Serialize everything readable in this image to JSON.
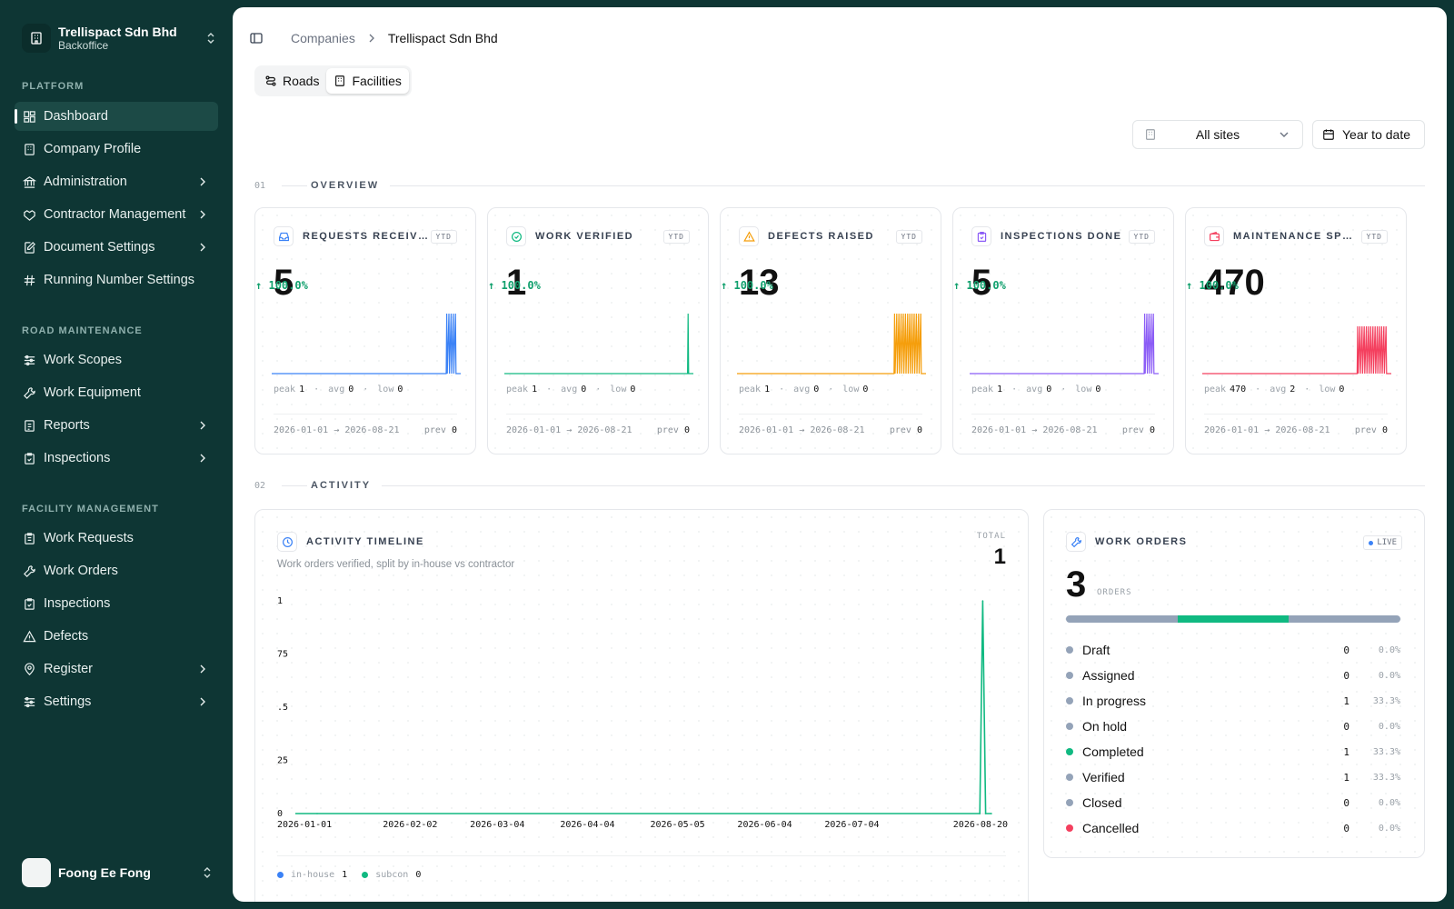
{
  "org": {
    "name": "Trellispact Sdn Bhd",
    "sub": "Backoffice"
  },
  "nav": {
    "platform_label": "PLATFORM",
    "platform": [
      "Dashboard",
      "Company Profile",
      "Administration",
      "Contractor Management",
      "Document Settings",
      "Running Number Settings"
    ],
    "road_label": "ROAD MAINTENANCE",
    "road": [
      "Work Scopes",
      "Work Equipment",
      "Reports",
      "Inspections"
    ],
    "facility_label": "FACILITY MANAGEMENT",
    "facility": [
      "Work Requests",
      "Work Orders",
      "Inspections",
      "Defects",
      "Register",
      "Settings"
    ]
  },
  "user": {
    "name": "Foong Ee Fong"
  },
  "breadcrumb": {
    "parent": "Companies",
    "current": "Trellispact Sdn Bhd"
  },
  "tabs": [
    "Roads",
    "Facilities"
  ],
  "filters": {
    "site": "All sites",
    "range": "Year to date"
  },
  "sections": {
    "overview": {
      "num": "01",
      "title": "OVERVIEW"
    },
    "activity": {
      "num": "02",
      "title": "ACTIVITY"
    }
  },
  "kpis": [
    {
      "title": "REQUESTS RECEIV…",
      "badge": "YTD",
      "value": "5",
      "delta": "100.0%",
      "peak": "1",
      "avg": "0",
      "low": "0",
      "from": "2026-01-01",
      "to": "2026-08-21",
      "prev": "0",
      "color": "#3b82f6",
      "icon": "inbox-icon"
    },
    {
      "title": "WORK VERIFIED",
      "badge": "YTD",
      "value": "1",
      "delta": "100.0%",
      "peak": "1",
      "avg": "0",
      "low": "0",
      "from": "2026-01-01",
      "to": "2026-08-21",
      "prev": "0",
      "color": "#10b981",
      "icon": "check-circle-icon"
    },
    {
      "title": "DEFECTS RAISED",
      "badge": "YTD",
      "value": "13",
      "delta": "100.0%",
      "peak": "1",
      "avg": "0",
      "low": "0",
      "from": "2026-01-01",
      "to": "2026-08-21",
      "prev": "0",
      "color": "#f59e0b",
      "icon": "warning-icon"
    },
    {
      "title": "INSPECTIONS DONE",
      "badge": "YTD",
      "value": "5",
      "delta": "100.0%",
      "peak": "1",
      "avg": "0",
      "low": "0",
      "from": "2026-01-01",
      "to": "2026-08-21",
      "prev": "0",
      "color": "#8b5cf6",
      "icon": "clipboard-check-icon"
    },
    {
      "title": "MAINTENANCE SP…",
      "badge": "YTD",
      "value": "470",
      "delta": "100.0%",
      "peak": "470",
      "avg": "2",
      "low": "0",
      "from": "2026-01-01",
      "to": "2026-08-21",
      "prev": "0",
      "color": "#f43f5e",
      "icon": "wallet-icon"
    }
  ],
  "stat_labels": {
    "peak": "peak",
    "avg": "avg",
    "low": "low",
    "prev": "prev",
    "arrow": "→"
  },
  "timeline": {
    "title": "ACTIVITY TIMELINE",
    "subtitle": "Work orders verified, split by in-house vs contractor",
    "total_label": "TOTAL",
    "total": "1",
    "legend": [
      {
        "name": "in-house",
        "value": "1",
        "color": "#3b82f6"
      },
      {
        "name": "subcon",
        "value": "0",
        "color": "#10b981"
      }
    ]
  },
  "chart_data": {
    "type": "line",
    "title": "",
    "ylim": [
      0,
      1
    ],
    "y_ticks": [
      "0",
      "25",
      ".5",
      "75",
      "1"
    ],
    "x_ticks": [
      "2026-01-01",
      "2026-02-02",
      "2026-03-04",
      "2026-04-04",
      "2026-05-05",
      "2026-06-04",
      "2026-07-04",
      "2026-08-20"
    ],
    "x_start": "2026-01-01",
    "x_end": "2026-08-21",
    "series": [
      {
        "points": [
          [
            "2026-01-01",
            0
          ],
          [
            "2026-08-17",
            0
          ],
          [
            "2026-08-18",
            1
          ],
          [
            "2026-08-19",
            0
          ],
          [
            "2026-08-21",
            0
          ]
        ],
        "color": "#10b981"
      }
    ]
  },
  "work_orders": {
    "title": "WORK ORDERS",
    "live": "LIVE",
    "total": "3",
    "unit": "ORDERS",
    "bar": [
      {
        "fraction": 0.3333,
        "color": "#94a3b8"
      },
      {
        "fraction": 0.3333,
        "color": "#10b981"
      },
      {
        "fraction": 0.3334,
        "color": "#94a3b8"
      }
    ],
    "statuses": [
      {
        "label": "Draft",
        "count": "0",
        "pct": "0.0%",
        "color": "#94a3b8"
      },
      {
        "label": "Assigned",
        "count": "0",
        "pct": "0.0%",
        "color": "#94a3b8"
      },
      {
        "label": "In progress",
        "count": "1",
        "pct": "33.3%",
        "color": "#94a3b8"
      },
      {
        "label": "On hold",
        "count": "0",
        "pct": "0.0%",
        "color": "#94a3b8"
      },
      {
        "label": "Completed",
        "count": "1",
        "pct": "33.3%",
        "color": "#10b981"
      },
      {
        "label": "Verified",
        "count": "1",
        "pct": "33.3%",
        "color": "#94a3b8"
      },
      {
        "label": "Closed",
        "count": "0",
        "pct": "0.0%",
        "color": "#94a3b8"
      },
      {
        "label": "Cancelled",
        "count": "0",
        "pct": "0.0%",
        "color": "#f43f5e"
      }
    ]
  }
}
